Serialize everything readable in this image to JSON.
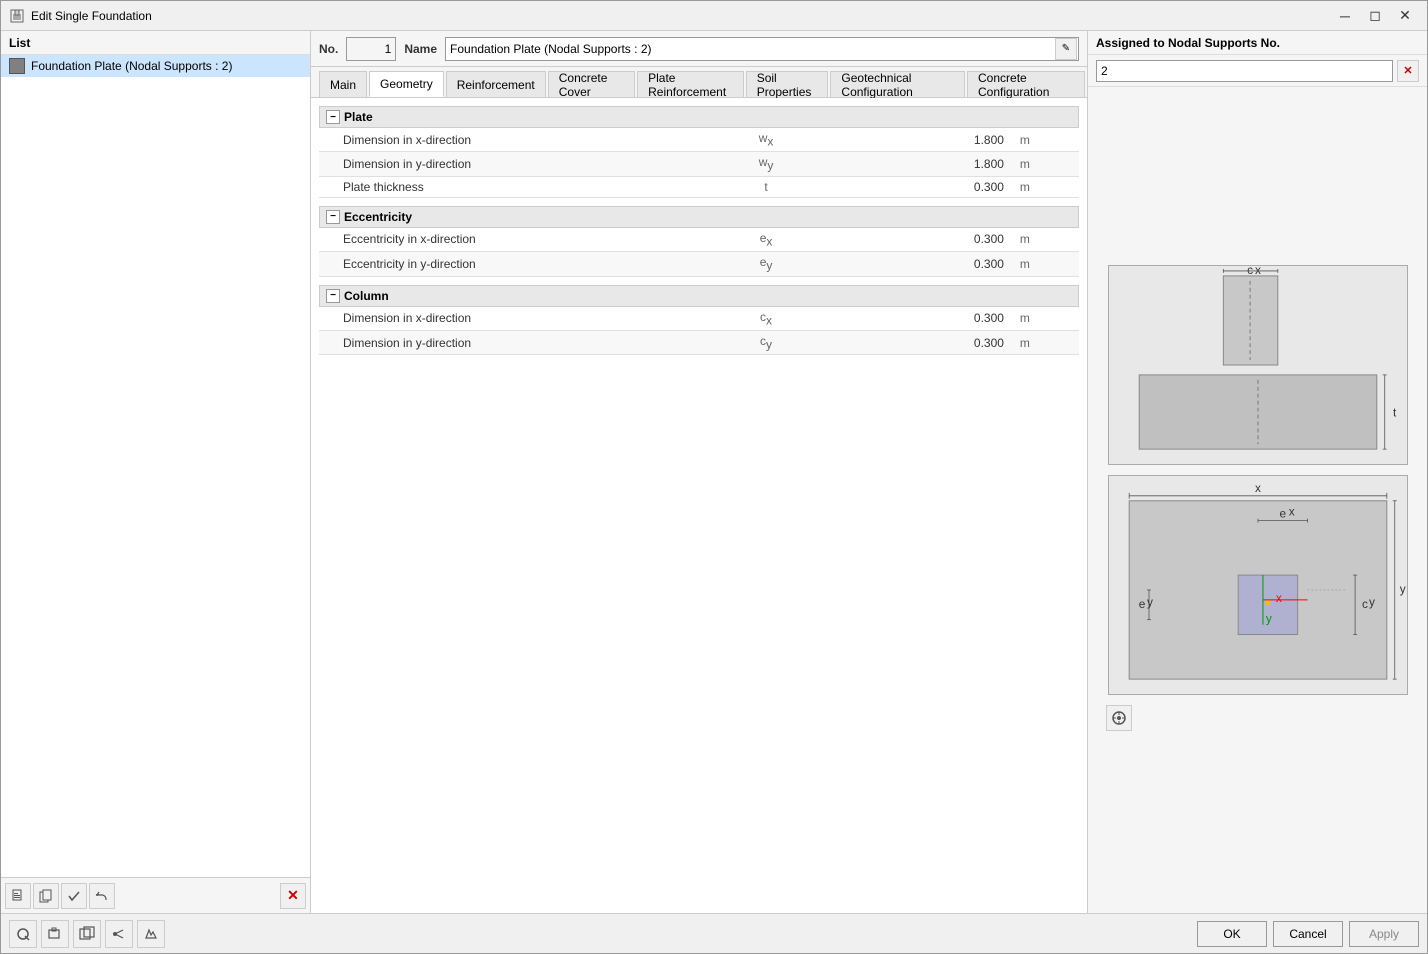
{
  "window": {
    "title": "Edit Single Foundation",
    "icon": "✦"
  },
  "list": {
    "header": "List",
    "items": [
      {
        "id": 1,
        "label": "Foundation Plate (Nodal Supports : 2)",
        "selected": true
      }
    ]
  },
  "fields": {
    "no_label": "No.",
    "no_value": "1",
    "name_label": "Name",
    "name_value": "Foundation Plate (Nodal Supports : 2)",
    "assigned_label": "Assigned to Nodal Supports No.",
    "assigned_value": "2"
  },
  "tabs": [
    {
      "id": "main",
      "label": "Main",
      "active": false
    },
    {
      "id": "geometry",
      "label": "Geometry",
      "active": true
    },
    {
      "id": "reinforcement",
      "label": "Reinforcement",
      "active": false
    },
    {
      "id": "concrete-cover",
      "label": "Concrete Cover",
      "active": false
    },
    {
      "id": "plate-reinforcement",
      "label": "Plate Reinforcement",
      "active": false
    },
    {
      "id": "soil-properties",
      "label": "Soil Properties",
      "active": false
    },
    {
      "id": "geotechnical-configuration",
      "label": "Geotechnical Configuration",
      "active": false
    },
    {
      "id": "concrete-configuration",
      "label": "Concrete Configuration",
      "active": false
    }
  ],
  "sections": {
    "plate": {
      "title": "Plate",
      "rows": [
        {
          "label": "Dimension in x-direction",
          "symbol": "wx",
          "value": "1.800",
          "unit": "m"
        },
        {
          "label": "Dimension in y-direction",
          "symbol": "wy",
          "value": "1.800",
          "unit": "m"
        },
        {
          "label": "Plate thickness",
          "symbol": "t",
          "value": "0.300",
          "unit": "m"
        }
      ]
    },
    "eccentricity": {
      "title": "Eccentricity",
      "rows": [
        {
          "label": "Eccentricity in x-direction",
          "symbol": "ex",
          "value": "0.300",
          "unit": "m"
        },
        {
          "label": "Eccentricity in y-direction",
          "symbol": "ey",
          "value": "0.300",
          "unit": "m"
        }
      ]
    },
    "column": {
      "title": "Column",
      "rows": [
        {
          "label": "Dimension in x-direction",
          "symbol": "cx",
          "value": "0.300",
          "unit": "m"
        },
        {
          "label": "Dimension in y-direction",
          "symbol": "cy",
          "value": "0.300",
          "unit": "m"
        }
      ]
    }
  },
  "buttons": {
    "ok": "OK",
    "cancel": "Cancel",
    "apply": "Apply"
  },
  "toolbar": {
    "tools": [
      "📁",
      "💾",
      "✔",
      "↩"
    ]
  }
}
